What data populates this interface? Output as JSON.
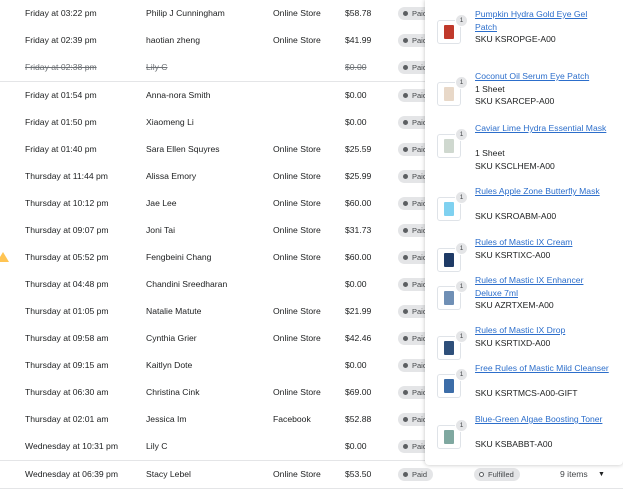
{
  "orders": [
    {
      "date": "Friday at 03:22 pm",
      "customer": "Philip J Cunningham",
      "channel": "Online Store",
      "total": "$58.78",
      "payment": "Paid",
      "striked": false
    },
    {
      "date": "Friday at 02:39 pm",
      "customer": "haotian zheng",
      "channel": "Online Store",
      "total": "$41.99",
      "payment": "Paid",
      "striked": false
    },
    {
      "date": "Friday at 02:38 pm",
      "customer": "Lily C",
      "channel": "",
      "total": "$0.00",
      "payment": "Paid",
      "striked": true
    },
    {
      "date": "Friday at 01:54 pm",
      "customer": "Anna-nora Smith",
      "channel": "",
      "total": "$0.00",
      "payment": "Paid",
      "striked": false
    },
    {
      "date": "Friday at 01:50 pm",
      "customer": "Xiaomeng Li",
      "channel": "",
      "total": "$0.00",
      "payment": "Paid",
      "striked": false
    },
    {
      "date": "Friday at 01:40 pm",
      "customer": "Sara Ellen Squyres",
      "channel": "Online Store",
      "total": "$25.59",
      "payment": "Paid",
      "striked": false
    },
    {
      "date": "Thursday at 11:44 pm",
      "customer": "Alissa Emory",
      "channel": "Online Store",
      "total": "$25.99",
      "payment": "Paid",
      "striked": false
    },
    {
      "date": "Thursday at 10:12 pm",
      "customer": "Jae Lee",
      "channel": "Online Store",
      "total": "$60.00",
      "payment": "Paid",
      "striked": false
    },
    {
      "date": "Thursday at 09:07 pm",
      "customer": "Joni Tai",
      "channel": "Online Store",
      "total": "$31.73",
      "payment": "Paid",
      "striked": false
    },
    {
      "date": "Thursday at 05:52 pm",
      "customer": "Fengbeini Chang",
      "channel": "Online Store",
      "total": "$60.00",
      "payment": "Paid",
      "striked": false,
      "warning": true
    },
    {
      "date": "Thursday at 04:48 pm",
      "customer": "Chandini Sreedharan",
      "channel": "",
      "total": "$0.00",
      "payment": "Paid",
      "striked": false
    },
    {
      "date": "Thursday at 01:05 pm",
      "customer": "Natalie Matute",
      "channel": "Online Store",
      "total": "$21.99",
      "payment": "Paid",
      "striked": false
    },
    {
      "date": "Thursday at 09:58 am",
      "customer": "Cynthia Grier",
      "channel": "Online Store",
      "total": "$42.46",
      "payment": "Paid",
      "striked": false
    },
    {
      "date": "Thursday at 09:15 am",
      "customer": "Kaitlyn Dote",
      "channel": "",
      "total": "$0.00",
      "payment": "Paid",
      "striked": false
    },
    {
      "date": "Thursday at 06:30 am",
      "customer": "Christina Cink",
      "channel": "Online Store",
      "total": "$69.00",
      "payment": "Paid",
      "striked": false
    },
    {
      "date": "Thursday at 02:01 am",
      "customer": "Jessica Im",
      "channel": "Facebook",
      "total": "$52.88",
      "payment": "Paid",
      "striked": false
    },
    {
      "date": "Wednesday at 10:31 pm",
      "customer": "Lily C",
      "channel": "",
      "total": "$0.00",
      "payment": "Paid",
      "striked": false
    },
    {
      "date": "Wednesday at 06:39 pm",
      "customer": "Stacy Lebel",
      "channel": "Online Store",
      "total": "$53.50",
      "payment": "Paid",
      "fulfillment": "Fulfilled",
      "items": "9 items",
      "striked": false
    }
  ],
  "popover_items": [
    {
      "qty": "1",
      "name": "Pumpkin Hydra Gold Eye Gel Patch",
      "lines": 2,
      "variant": "",
      "sku": "SKU KSROPGE-A00",
      "color": "#c0392b"
    },
    {
      "qty": "1",
      "name": "Coconut Oil Serum Eye Patch",
      "lines": 1,
      "variant": "1 Sheet",
      "sku": "SKU KSARCEP-A00",
      "color": "#e8d8c8"
    },
    {
      "qty": "1",
      "name": "Caviar Lime Hydra Essential Mask",
      "lines": 2,
      "variant": "1 Sheet",
      "sku": "SKU KSCLHEM-A00",
      "color": "#cfd8cf"
    },
    {
      "qty": "1",
      "name": "Rules Apple Zone Butterfly Mask",
      "lines": 2,
      "variant": "",
      "sku": "SKU KSROABM-A00",
      "color": "#7fd1f0"
    },
    {
      "qty": "1",
      "name": "Rules of Mastic IX Cream",
      "lines": 1,
      "variant": "",
      "sku": "SKU KSRTIXC-A00",
      "color": "#1f3b66"
    },
    {
      "qty": "1",
      "name": "Rules of Mastic IX Enhancer Deluxe 7ml",
      "lines": 2,
      "variant": "",
      "sku": "SKU AZRTXEM-A00",
      "color": "#6f8fb5"
    },
    {
      "qty": "1",
      "name": "Rules of Mastic IX Drop",
      "lines": 1,
      "variant": "",
      "sku": "SKU KSRTIXD-A00",
      "color": "#2e4f7a"
    },
    {
      "qty": "1",
      "name": "Free Rules of Mastic Mild Cleanser",
      "lines": 2,
      "variant": "",
      "sku": "SKU KSRTMCS-A00-GIFT",
      "color": "#3c6da8"
    },
    {
      "qty": "1",
      "name": "Blue-Green Algae Boosting Toner",
      "lines": 2,
      "variant": "",
      "sku": "SKU KSBABBT-A00",
      "color": "#7fa8a0"
    }
  ]
}
